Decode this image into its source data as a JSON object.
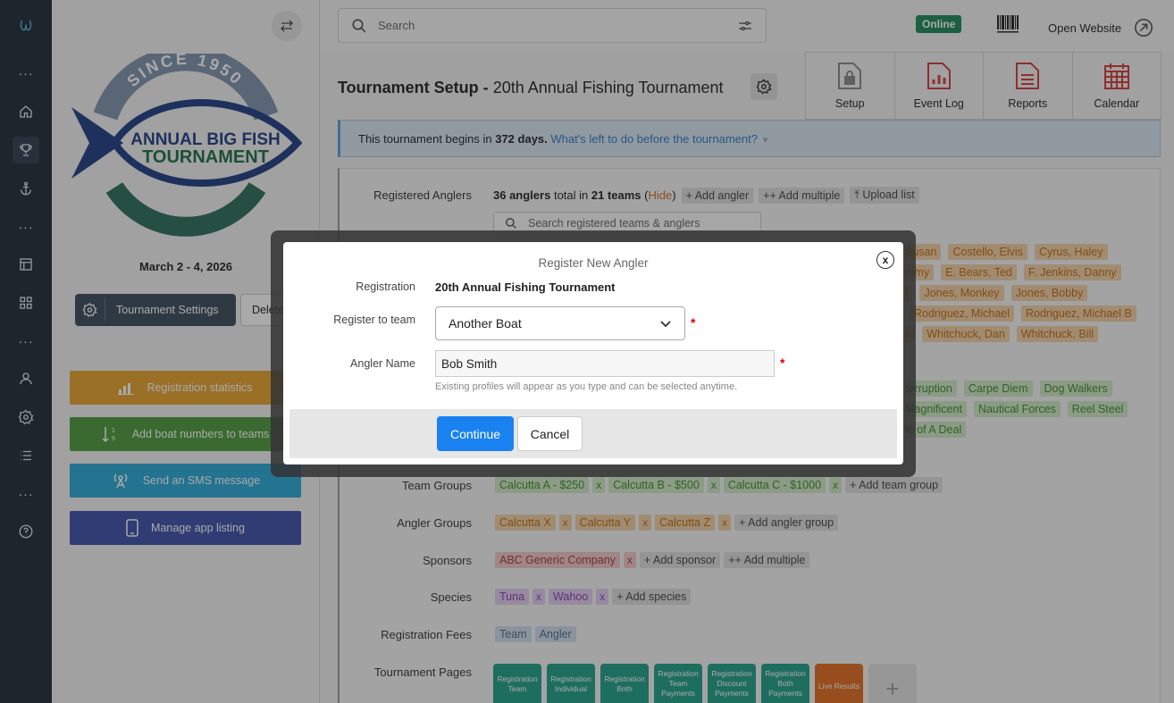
{
  "rail": {
    "items": [
      "logo",
      "more",
      "home",
      "trophy",
      "anchor",
      "more",
      "layout",
      "grid",
      "more",
      "user",
      "settings",
      "list",
      "more",
      "help"
    ]
  },
  "sidebar": {
    "logo": {
      "since": "SINCE 1950",
      "line1": "ANNUAL BIG FISH",
      "line2": "TOURNAMENT"
    },
    "dates": "March 2 - 4, 2026",
    "tournament_settings_label": "Tournament Settings",
    "delete_label": "Delete",
    "actions": [
      {
        "label": "Registration statistics",
        "icon": "bar-chart-icon"
      },
      {
        "label": "Add boat numbers to teams",
        "icon": "sort-numeric-icon"
      },
      {
        "label": "Send an SMS message",
        "icon": "broadcast-icon"
      },
      {
        "label": "Manage app listing",
        "icon": "mobile-icon"
      }
    ]
  },
  "topbar": {
    "search_placeholder": "Search",
    "status": "Online",
    "open_website": "Open Website"
  },
  "main": {
    "title_prefix": "Tournament Setup -",
    "title_name": "20th Annual Fishing Tournament",
    "tiles": [
      {
        "label": "Setup",
        "icon": "lock-file-icon"
      },
      {
        "label": "Event Log",
        "icon": "chart-file-icon"
      },
      {
        "label": "Reports",
        "icon": "document-icon"
      },
      {
        "label": "Calendar",
        "icon": "calendar-icon"
      }
    ],
    "banner": {
      "pre": "This tournament begins in",
      "days": "372 days.",
      "link": "What's left to do before the tournament?"
    },
    "anglers": {
      "label": "Registered Anglers",
      "count": "36 anglers",
      "total_in": "total in",
      "teams": "21 teams",
      "open_paren": "(",
      "hide": "Hide",
      "close_paren": ")",
      "add_angler": "+ Add angler",
      "add_multiple": "++ Add multiple",
      "upload_list": "Upload list",
      "search_placeholder": "Search registered teams & anglers"
    },
    "bg_orange_rows": [
      [
        "Susan",
        "Costello, Elvis",
        "Cyrus, Haley"
      ],
      [
        "mmy",
        "E. Bears, Ted",
        "F. Jenkins, Danny"
      ],
      [
        "f",
        "Jones, Monkey",
        "Jones, Bobby"
      ],
      [
        "",
        "Rodriguez, Michael",
        "Rodriguez, Michael B"
      ],
      [
        "k",
        "Whitchuck, Dan",
        "Whitchuck, Bill"
      ]
    ],
    "bg_green_rows": [
      [
        "terruption",
        "Carpe Diem",
        "Dog Walkers"
      ],
      [
        "Magnificent",
        "Nautical Forces",
        "Reel Steel"
      ],
      [
        "le of A Deal"
      ]
    ],
    "team_groups": {
      "label": "Team Groups",
      "chips": [
        "Calcutta A - $250",
        "Calcutta B - $500",
        "Calcutta C - $1000"
      ],
      "add": "+ Add team group"
    },
    "angler_groups": {
      "label": "Angler Groups",
      "chips": [
        "Calcutta X",
        "Calcutta Y",
        "Calcutta Z"
      ],
      "add": "+ Add angler group"
    },
    "sponsors": {
      "label": "Sponsors",
      "chips": [
        "ABC Generic Company"
      ],
      "add": "+ Add sponsor",
      "add_multiple": "++ Add multiple"
    },
    "species": {
      "label": "Species",
      "chips": [
        "Tuna",
        "Wahoo"
      ],
      "add": "+ Add species"
    },
    "fees": {
      "label": "Registration Fees",
      "chips": [
        "Team",
        "Angler"
      ]
    },
    "pages": {
      "label": "Tournament Pages",
      "tiles": [
        "Registration Team",
        "Registration Individual",
        "Registration Both",
        "Registration Team Payments",
        "Registration Discount Payments",
        "Registration Both Payments",
        "Live Results"
      ],
      "add": "+"
    },
    "remove_mark": "x"
  },
  "modal": {
    "title": "Register New Angler",
    "close": "x",
    "registration_label": "Registration",
    "registration_value": "20th Annual Fishing Tournament",
    "team_label": "Register to team",
    "team_value": "Another Boat",
    "name_label": "Angler Name",
    "name_value": "Bob Smith",
    "help": "Existing profiles will appear as you type and can be selected anytime.",
    "required_mark": "*",
    "continue": "Continue",
    "cancel": "Cancel"
  }
}
